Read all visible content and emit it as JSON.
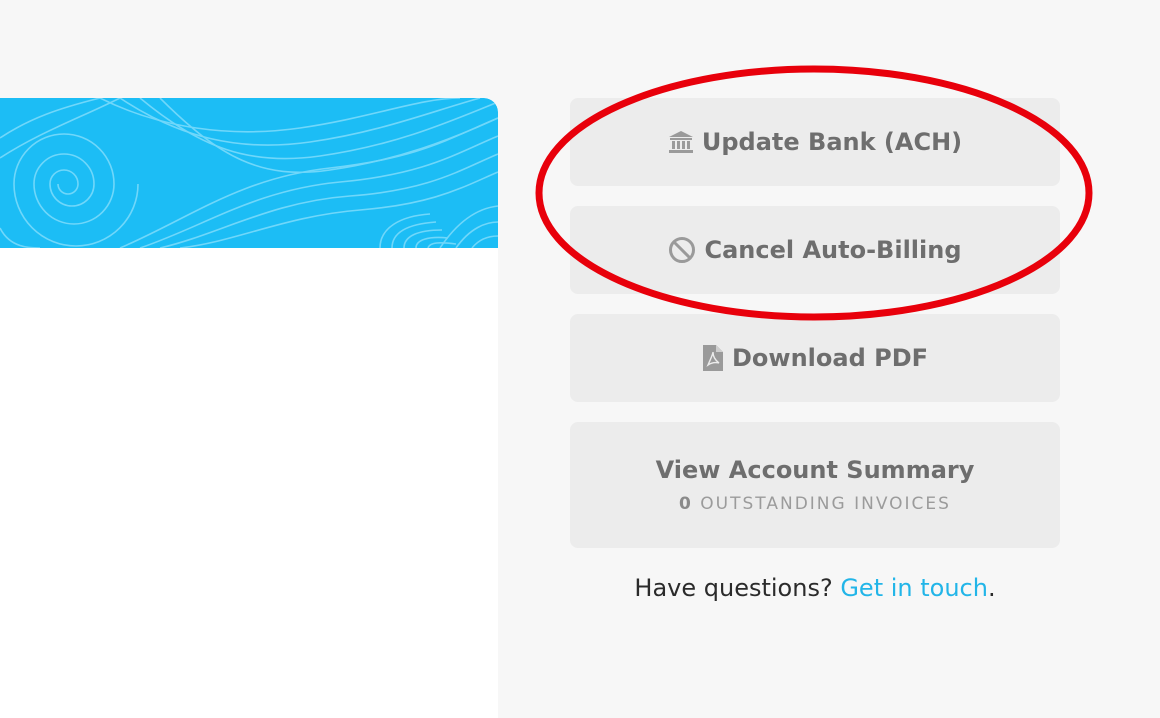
{
  "colors": {
    "banner": "#1cbdf5",
    "button_bg": "#ececec",
    "button_text": "#6e6e6e",
    "link": "#22b5e8",
    "annotation": "#e8000b"
  },
  "actions": {
    "update_bank": {
      "label": "Update Bank (ACH)",
      "icon": "bank-icon"
    },
    "cancel_billing": {
      "label": "Cancel Auto-Billing",
      "icon": "ban-icon"
    },
    "download_pdf": {
      "label": "Download PDF",
      "icon": "pdf-file-icon"
    },
    "account_summary": {
      "label": "View Account Summary",
      "outstanding_count": "0",
      "outstanding_label": "OUTSTANDING INVOICES"
    }
  },
  "help": {
    "prefix": "Have questions?",
    "link_label": "Get in touch",
    "suffix": "."
  }
}
